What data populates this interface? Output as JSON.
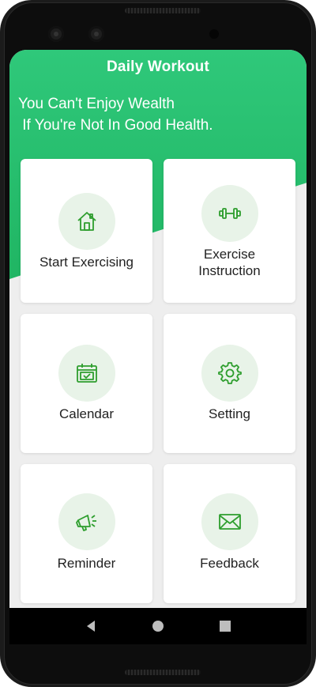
{
  "header": {
    "title": "Daily Workout",
    "quote": "You Can't Enjoy Wealth\n If You're Not In Good Health."
  },
  "menu": [
    {
      "label": "Start Exercising",
      "icon": "home-icon"
    },
    {
      "label": "Exercise\nInstruction",
      "icon": "dumbbell-icon"
    },
    {
      "label": "Calendar",
      "icon": "calendar-icon"
    },
    {
      "label": "Setting",
      "icon": "gear-icon"
    },
    {
      "label": "Reminder",
      "icon": "megaphone-icon"
    },
    {
      "label": "Feedback",
      "icon": "envelope-icon"
    }
  ],
  "navbar": {
    "back": "back-icon",
    "home": "home-circle-icon",
    "recents": "recents-icon"
  },
  "colors": {
    "accent": "#2fc87a",
    "icon_green": "#2e9e2e",
    "icon_bg": "#e8f3e8"
  }
}
